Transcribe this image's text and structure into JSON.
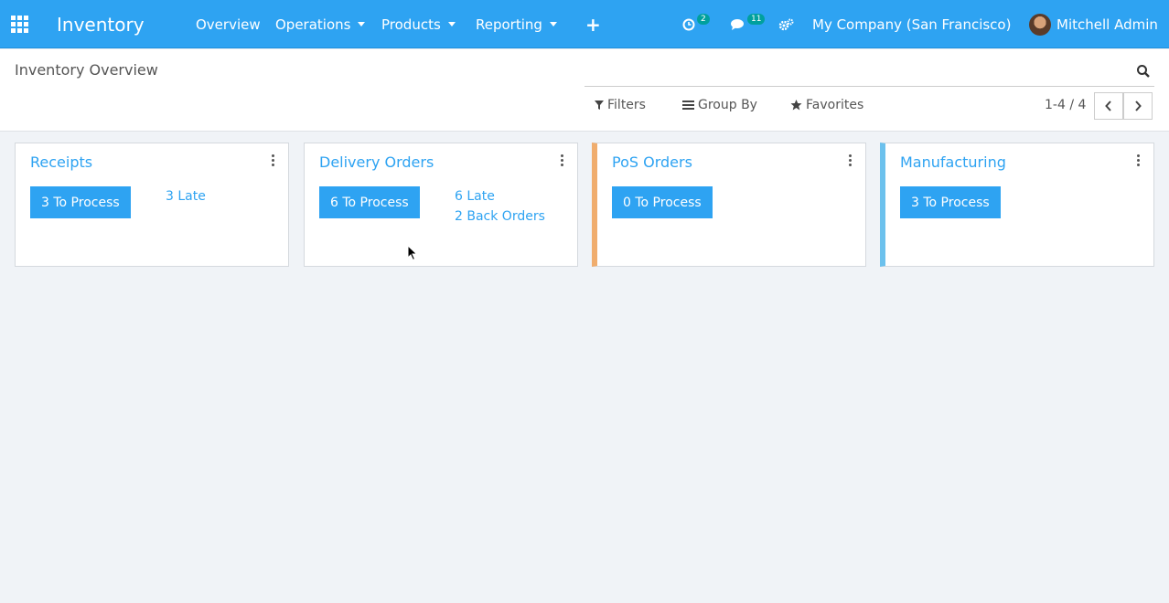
{
  "navbar": {
    "app_name": "Inventory",
    "menu": [
      {
        "label": "Overview",
        "has_caret": false
      },
      {
        "label": "Operations",
        "has_caret": true
      },
      {
        "label": "Products",
        "has_caret": true
      },
      {
        "label": "Reporting",
        "has_caret": true
      }
    ],
    "activity_badge": "2",
    "messages_badge": "11",
    "company": "My Company (San Francisco)",
    "user": "Mitchell Admin"
  },
  "control_panel": {
    "title": "Inventory Overview",
    "filters_label": "Filters",
    "group_by_label": "Group By",
    "favorites_label": "Favorites",
    "pager": "1-4 / 4"
  },
  "cards": [
    {
      "title": "Receipts",
      "button": "3 To Process",
      "links": [
        "3 Late"
      ]
    },
    {
      "title": "Delivery Orders",
      "button": "6 To Process",
      "links": [
        "6 Late",
        "2 Back Orders"
      ]
    },
    {
      "title": "PoS Orders",
      "button": "0 To Process",
      "links": []
    },
    {
      "title": "Manufacturing",
      "button": "3 To Process",
      "links": []
    }
  ],
  "colors": {
    "brand": "#2ea3f2",
    "pos_bar": "#f0ad6e",
    "manufacturing_bar": "#6cc1ed"
  }
}
